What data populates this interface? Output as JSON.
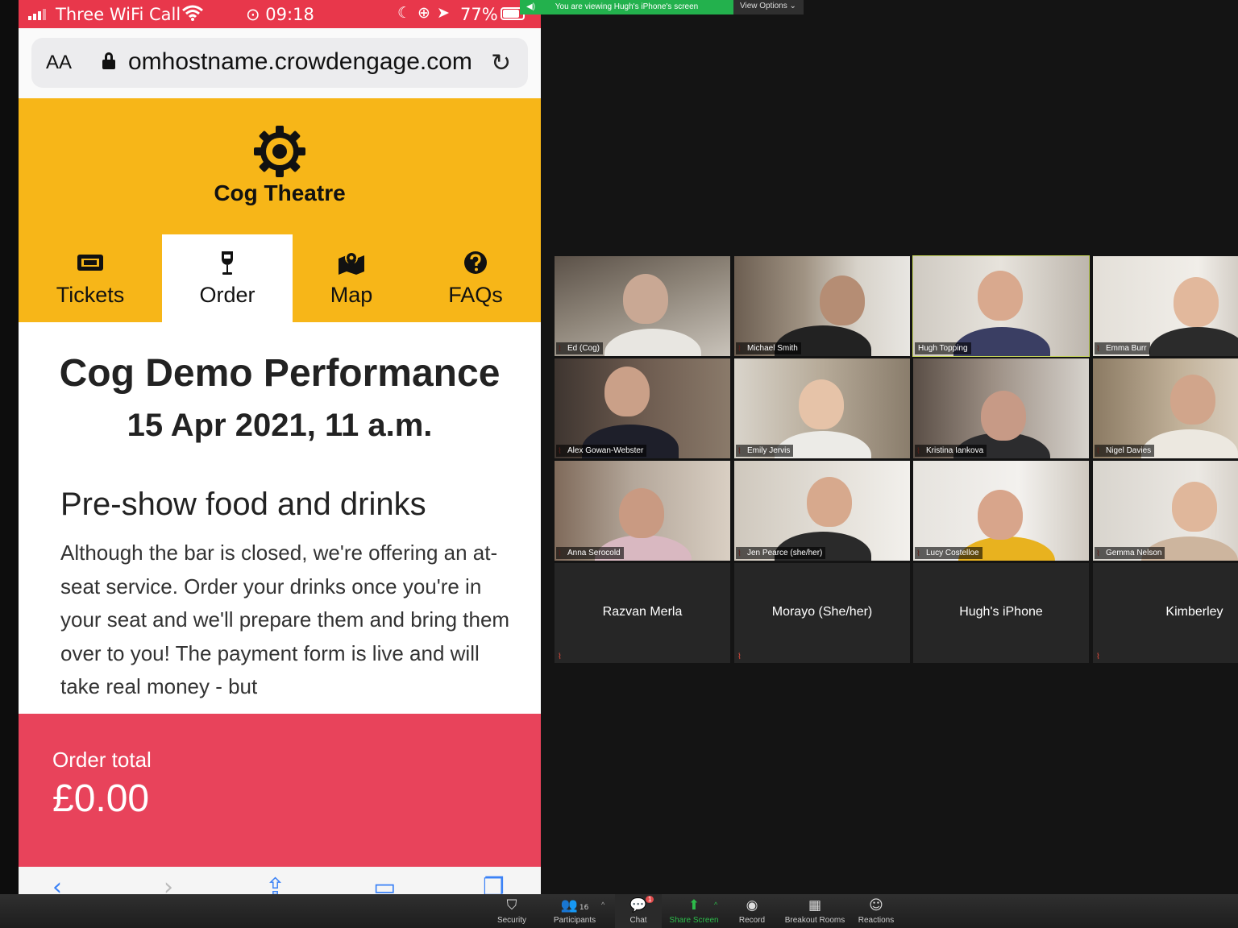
{
  "phone": {
    "status": {
      "carrier": "Three WiFi Call",
      "time": "09:18",
      "battery": "77%"
    },
    "safari": {
      "text_size": "AA",
      "url": "omhostname.crowdengage.com"
    },
    "site": {
      "name": "Cog Theatre",
      "tabs": [
        {
          "label": "Tickets",
          "icon": "ticket-icon"
        },
        {
          "label": "Order",
          "icon": "wine-glass-icon",
          "active": true
        },
        {
          "label": "Map",
          "icon": "map-icon"
        },
        {
          "label": "FAQs",
          "icon": "question-circle-icon"
        }
      ],
      "performance_title": "Cog Demo Performance",
      "performance_date": "15 Apr 2021, 11 a.m.",
      "section_title": "Pre-show food and drinks",
      "section_body": "Although the bar is closed, we're offering an at-seat service. Order your drinks once you're in your seat and we'll prepare them and bring them over to you! The payment form is live and will take real money - but",
      "order_label": "Order total",
      "order_total": "£0.00"
    },
    "colors": {
      "status_bar": "#e8374b",
      "brand_yellow": "#f7b618",
      "order_panel": "#e8435b"
    }
  },
  "zoom": {
    "banner": "You are viewing Hugh's iPhone's screen",
    "view_options": "View Options ⌄",
    "participants": [
      {
        "name": "Ed (Cog)",
        "muted": true
      },
      {
        "name": "Michael Smith",
        "muted": true
      },
      {
        "name": "Hugh Topping",
        "muted": false,
        "speaking": true
      },
      {
        "name": "Emma Burr",
        "muted": true
      },
      {
        "name": "Alex Gowan-Webster",
        "muted": true
      },
      {
        "name": "Emily Jervis",
        "muted": true
      },
      {
        "name": "Kristina Iankova",
        "muted": true
      },
      {
        "name": "Nigel Davies",
        "muted": true
      },
      {
        "name": "Anna Serocold",
        "muted": true
      },
      {
        "name": "Jen Pearce (she/her)",
        "muted": true
      },
      {
        "name": "Lucy Costelloe",
        "muted": true
      },
      {
        "name": "Gemma Nelson",
        "muted": true
      }
    ],
    "no_video": [
      {
        "name": "Razvan Merla",
        "muted": true
      },
      {
        "name": "Morayo (She/her)",
        "muted": true
      },
      {
        "name": "Hugh's iPhone",
        "muted": false
      },
      {
        "name": "Kimberley",
        "muted": true
      }
    ],
    "toolbar": {
      "security": "Security",
      "participants": "Participants",
      "participants_count": "16",
      "chat": "Chat",
      "chat_badge": "1",
      "share_screen": "Share Screen",
      "record": "Record",
      "breakout_rooms": "Breakout Rooms",
      "reactions": "Reactions"
    },
    "colors": {
      "share_green": "#2dbb4a",
      "speaker_outline": "#c9d95c",
      "banner_green": "#23b14d"
    }
  }
}
